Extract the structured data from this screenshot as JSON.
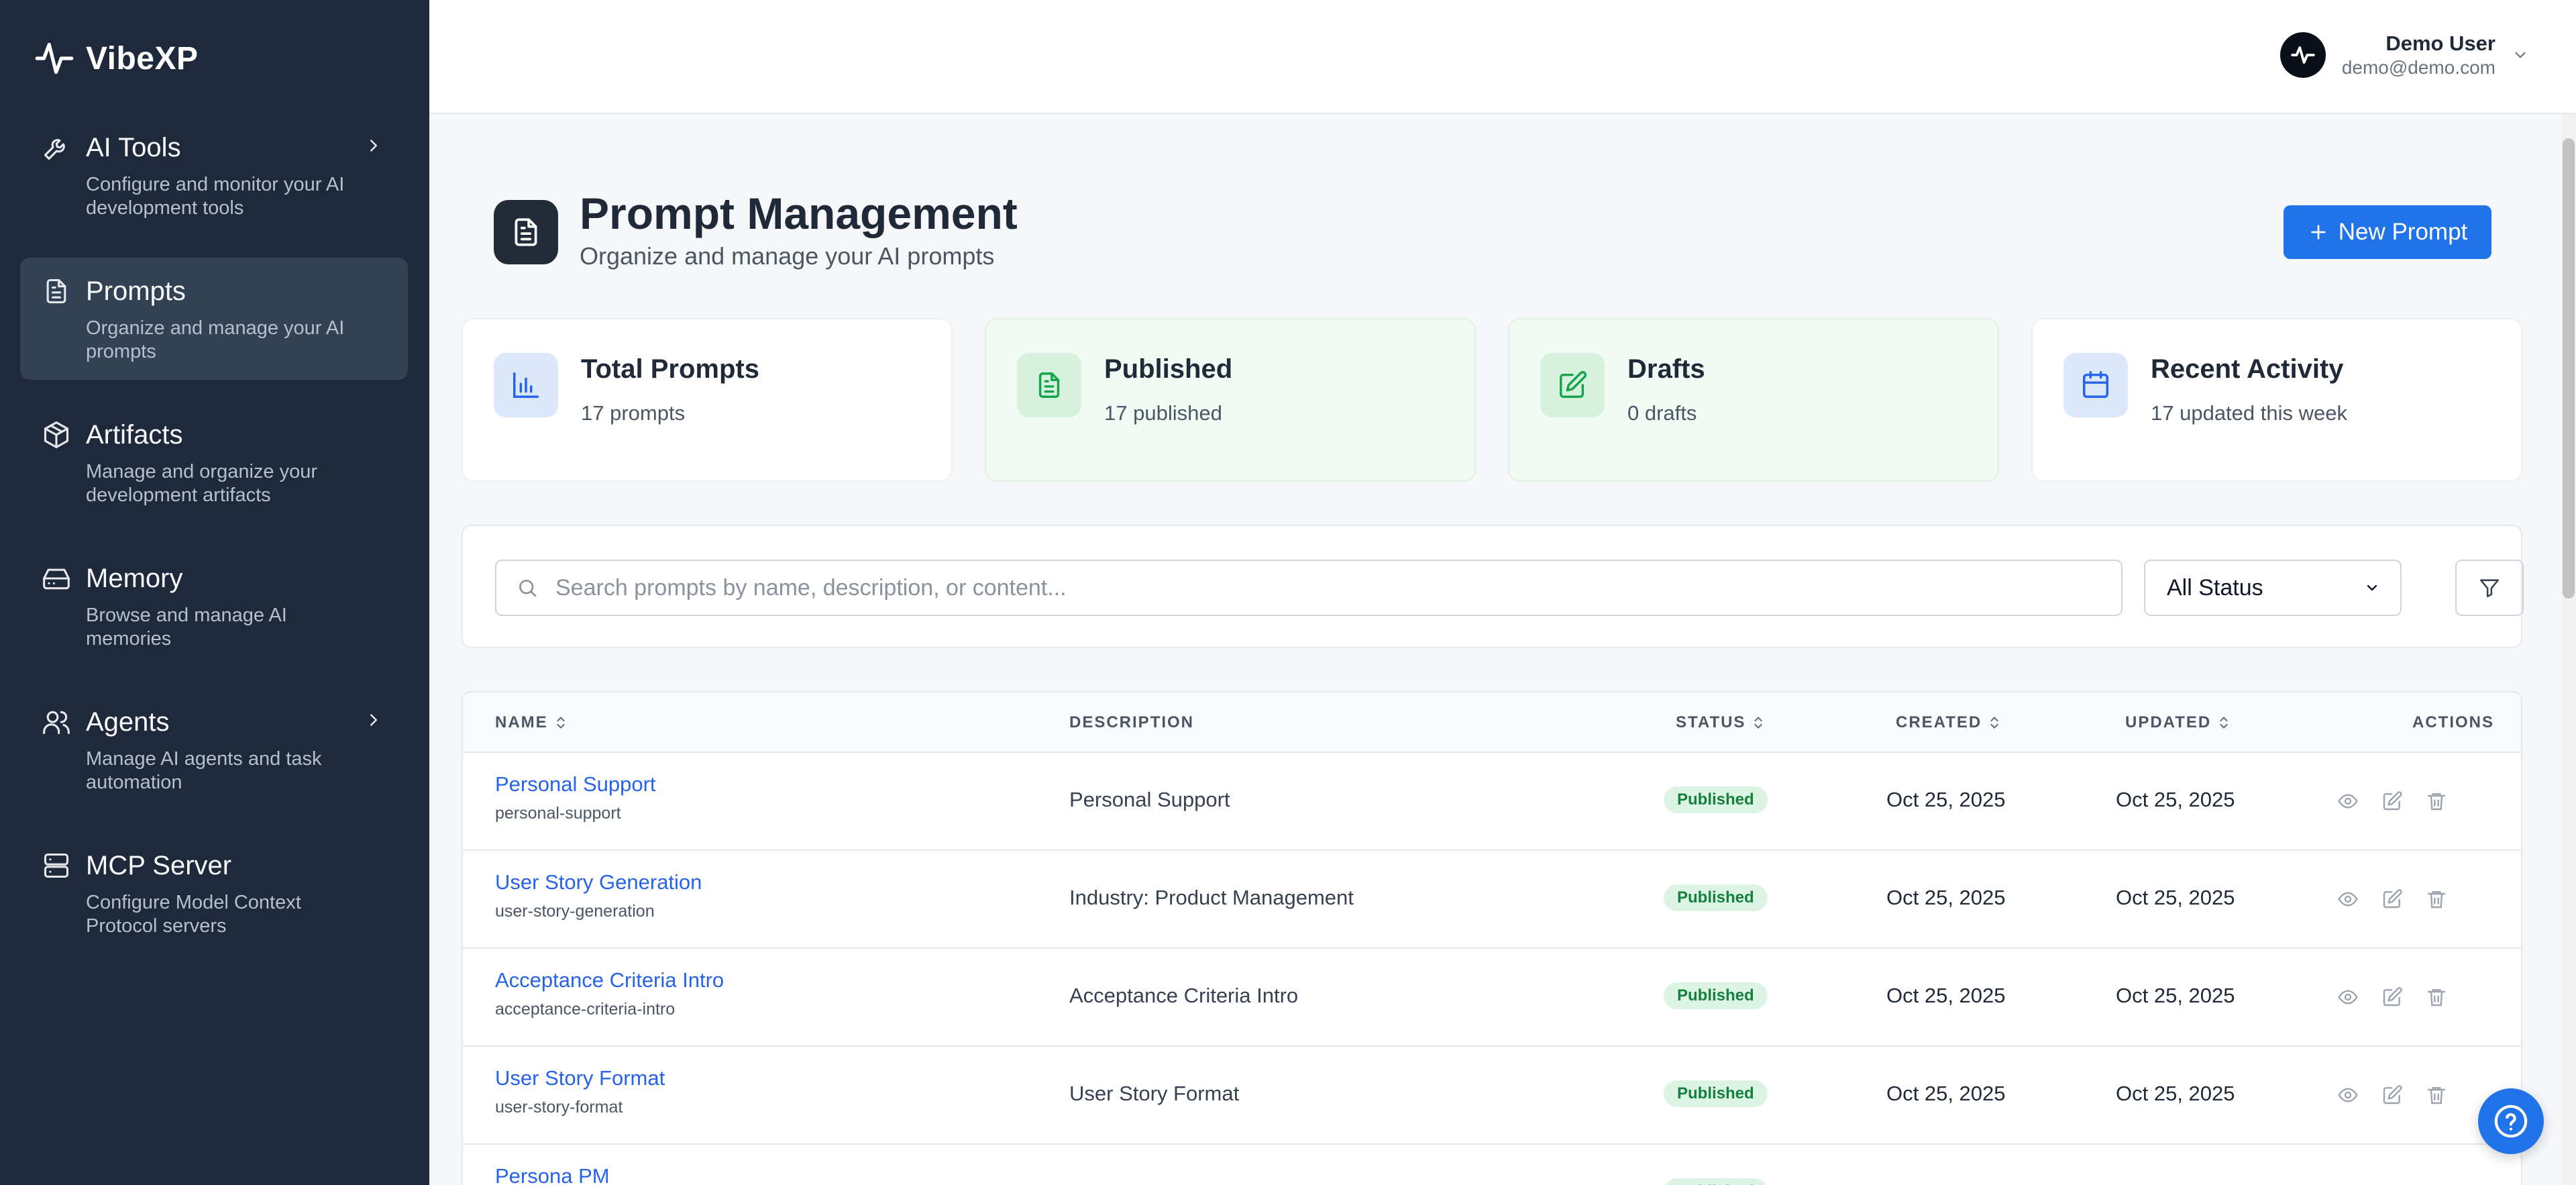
{
  "app": {
    "name": "VibeXP"
  },
  "sidebar": {
    "items": [
      {
        "label": "AI Tools",
        "desc": "Configure and monitor your AI development tools"
      },
      {
        "label": "Prompts",
        "desc": "Organize and manage your AI prompts"
      },
      {
        "label": "Artifacts",
        "desc": "Manage and organize your development artifacts"
      },
      {
        "label": "Memory",
        "desc": "Browse and manage AI memories"
      },
      {
        "label": "Agents",
        "desc": "Manage AI agents and task automation"
      },
      {
        "label": "MCP Server",
        "desc": "Configure Model Context Protocol servers"
      }
    ]
  },
  "user": {
    "name": "Demo User",
    "email": "demo@demo.com"
  },
  "page": {
    "title": "Prompt Management",
    "subtitle": "Organize and manage your AI prompts",
    "new_button": "New Prompt"
  },
  "stats": [
    {
      "label": "Total Prompts",
      "value": "17 prompts"
    },
    {
      "label": "Published",
      "value": "17 published"
    },
    {
      "label": "Drafts",
      "value": "0 drafts"
    },
    {
      "label": "Recent Activity",
      "value": "17 updated this week"
    }
  ],
  "filters": {
    "search_placeholder": "Search prompts by name, description, or content...",
    "status_selected": "All Status"
  },
  "table": {
    "headers": {
      "name": "NAME",
      "description": "DESCRIPTION",
      "status": "STATUS",
      "created": "CREATED",
      "updated": "UPDATED",
      "actions": "ACTIONS"
    },
    "rows": [
      {
        "name": "Personal Support",
        "slug": "personal-support",
        "description": "Personal Support",
        "status": "Published",
        "created": "Oct 25, 2025",
        "updated": "Oct 25, 2025"
      },
      {
        "name": "User Story Generation",
        "slug": "user-story-generation",
        "description": "Industry: Product Management",
        "status": "Published",
        "created": "Oct 25, 2025",
        "updated": "Oct 25, 2025"
      },
      {
        "name": "Acceptance Criteria Intro",
        "slug": "acceptance-criteria-intro",
        "description": "Acceptance Criteria Intro",
        "status": "Published",
        "created": "Oct 25, 2025",
        "updated": "Oct 25, 2025"
      },
      {
        "name": "User Story Format",
        "slug": "user-story-format",
        "description": "User Story Format",
        "status": "Published",
        "created": "Oct 25, 2025",
        "updated": "Oct 25, 2025"
      },
      {
        "name": "Persona PM",
        "slug": "",
        "description": "",
        "status": "Published",
        "created": "",
        "updated": ""
      }
    ]
  }
}
